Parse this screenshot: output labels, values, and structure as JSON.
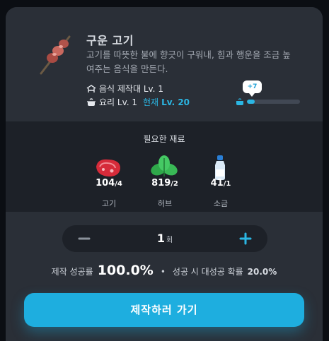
{
  "item": {
    "icon": "skewer-meat-icon",
    "title": "구운 고기",
    "description": "고기를 따뜻한 불에 향긋이 구워내, 힘과 행운을 조금 높여주는 음식을 만든다.",
    "requirements": [
      {
        "icon": "workbench-icon",
        "label": "음식 제작대 Lv. 1"
      },
      {
        "icon": "cooking-pot-icon",
        "label": "요리 Lv. 1",
        "current_label": "현재",
        "current_value": "Lv. 20"
      }
    ]
  },
  "exp": {
    "bubble": "+7",
    "progress_fraction": 0.15,
    "accent": "#2bb6e3"
  },
  "materials": {
    "title": "필요한 재료",
    "items": [
      {
        "icon": "raw-meat-icon",
        "have": "104",
        "need": "/4",
        "name": "고기"
      },
      {
        "icon": "herb-leaf-icon",
        "have": "819",
        "need": "/2",
        "name": "허브"
      },
      {
        "icon": "salt-bottle-icon",
        "have": "41",
        "need": "/1",
        "name": "소금"
      }
    ]
  },
  "quantity": {
    "minus_icon": "minus-icon",
    "plus_icon": "plus-icon",
    "value": "1",
    "unit": "회"
  },
  "rates": {
    "success_label": "제작 성공률",
    "success_value": "100.0%",
    "great_label": "성공 시 대성공 확률",
    "great_value": "20.0%"
  },
  "action": {
    "label": "제작하러 가기",
    "color": "#1eaedf"
  }
}
